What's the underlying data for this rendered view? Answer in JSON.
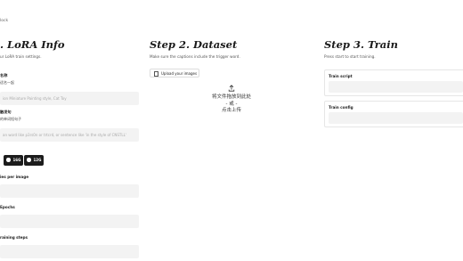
{
  "topbar": {
    "text": "lock"
  },
  "col1": {
    "title": ". LoRA Info",
    "desc": "ur LoRA train settings.",
    "name_label": "名称",
    "name_sub": "适名一起",
    "name_placeholder": "ion Miniature Painting style, Cat Toy",
    "trigger_label": "触发句",
    "trigger_sub": "的单词短句子",
    "trigger_placeholder": "an word like p3rs0n or trtcrd, or sentence like 'in the style of CNSTLL'",
    "radio_a": "16G",
    "radio_b": "12G",
    "repeats_label": "ies per image",
    "epochs_label": "Epochs",
    "steps_label": "raining steps"
  },
  "col2": {
    "title": "Step 2. Dataset",
    "desc": "Make sure the captions include the trigger word.",
    "upload_btn": "Upload your images",
    "drop_line1": "将文件拖放到此处",
    "drop_line2": "- 或 -",
    "drop_line3": "点击上传"
  },
  "col3": {
    "title": "Step 3. Train",
    "desc": "Press start to start training.",
    "script_label": "Train script",
    "config_label": "Train config"
  }
}
